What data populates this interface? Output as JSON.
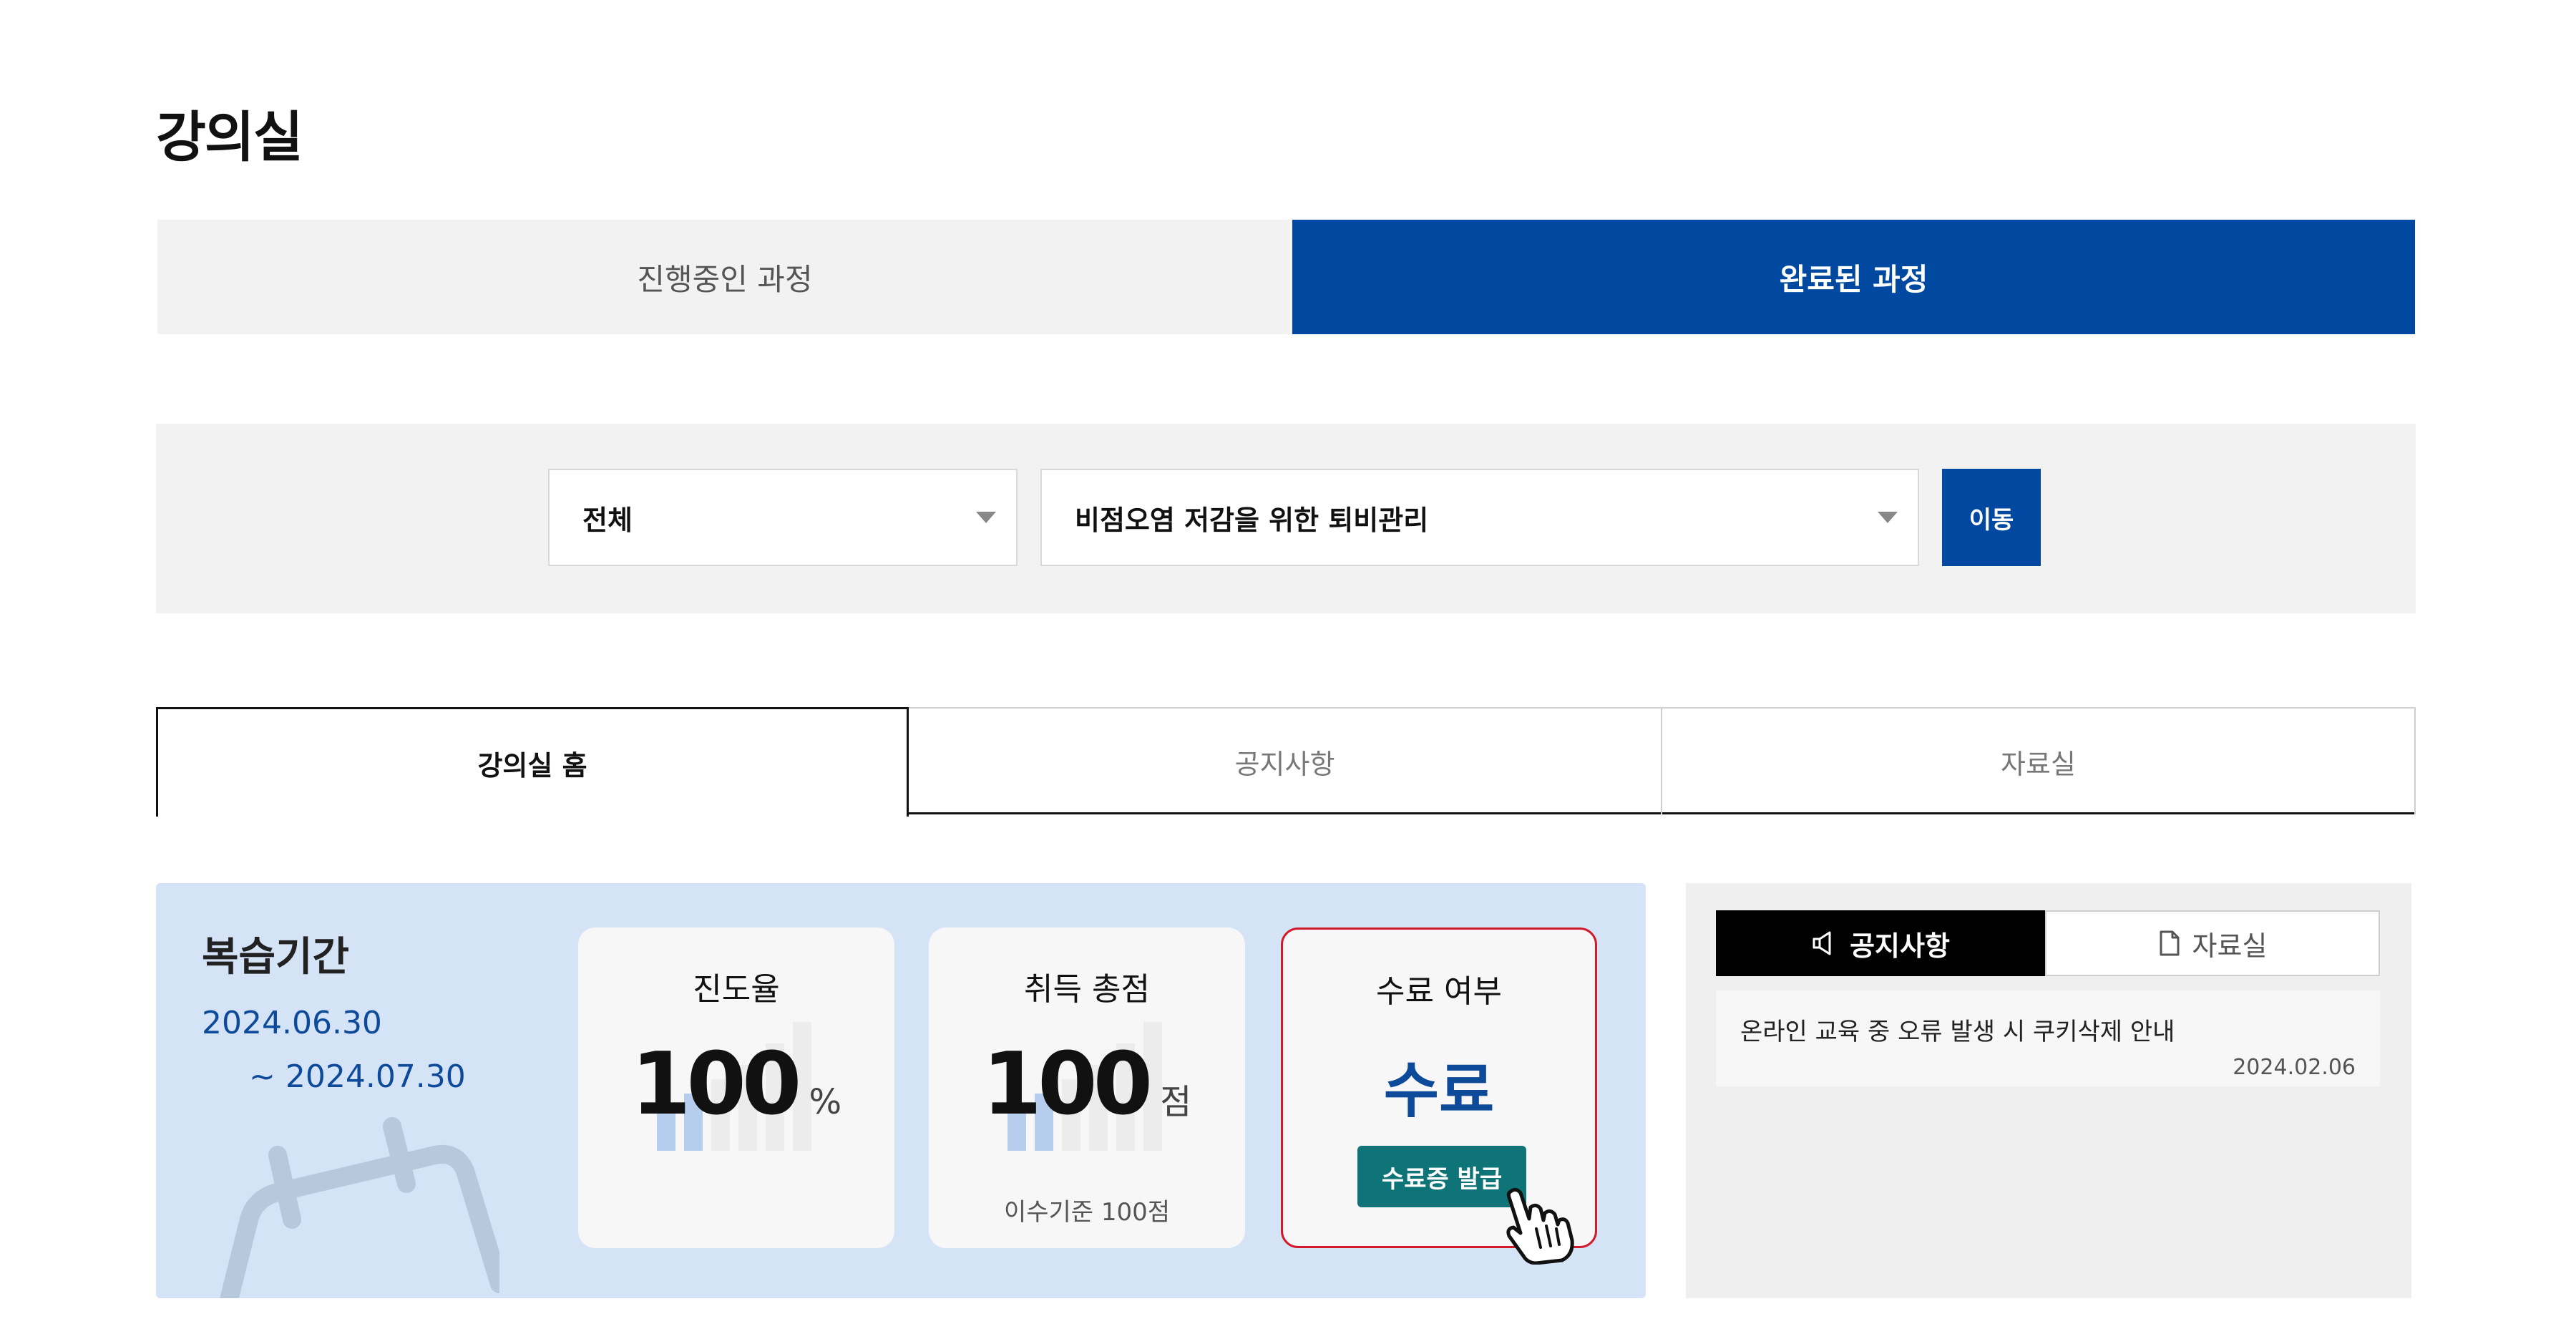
{
  "page": {
    "title": "강의실"
  },
  "status_tabs": [
    {
      "label": "진행중인 과정",
      "active": false
    },
    {
      "label": "완료된 과정",
      "active": true
    }
  ],
  "filter": {
    "category_value": "전체",
    "course_value": "비점오염 저감을 위한 퇴비관리",
    "go_label": "이동"
  },
  "room_tabs": [
    {
      "label": "강의실 홈",
      "active": true
    },
    {
      "label": "공지사항",
      "active": false
    },
    {
      "label": "자료실",
      "active": false
    }
  ],
  "review": {
    "title": "복습기간",
    "start": "2024.06.30",
    "end": "~ 2024.07.30"
  },
  "progress": {
    "label": "진도율",
    "value": "100",
    "unit": "%"
  },
  "score": {
    "label": "취득 총점",
    "value": "100",
    "unit": "점",
    "note": "이수기준 100점"
  },
  "completion": {
    "label": "수료 여부",
    "value": "수료",
    "button_label": "수료증 발급"
  },
  "notice_board": {
    "tabs": [
      {
        "label": "공지사항",
        "icon": "megaphone-icon",
        "active": true
      },
      {
        "label": "자료실",
        "icon": "document-icon",
        "active": false
      }
    ],
    "items": [
      {
        "title": "온라인 교육 중 오류 발생 시 쿠키삭제 안내",
        "date": "2024.02.06"
      }
    ]
  },
  "colors": {
    "primary": "#0149a0",
    "review_bg": "#d4e3f5",
    "highlight_border": "#d21a2a",
    "cert_button": "#0f7478"
  }
}
